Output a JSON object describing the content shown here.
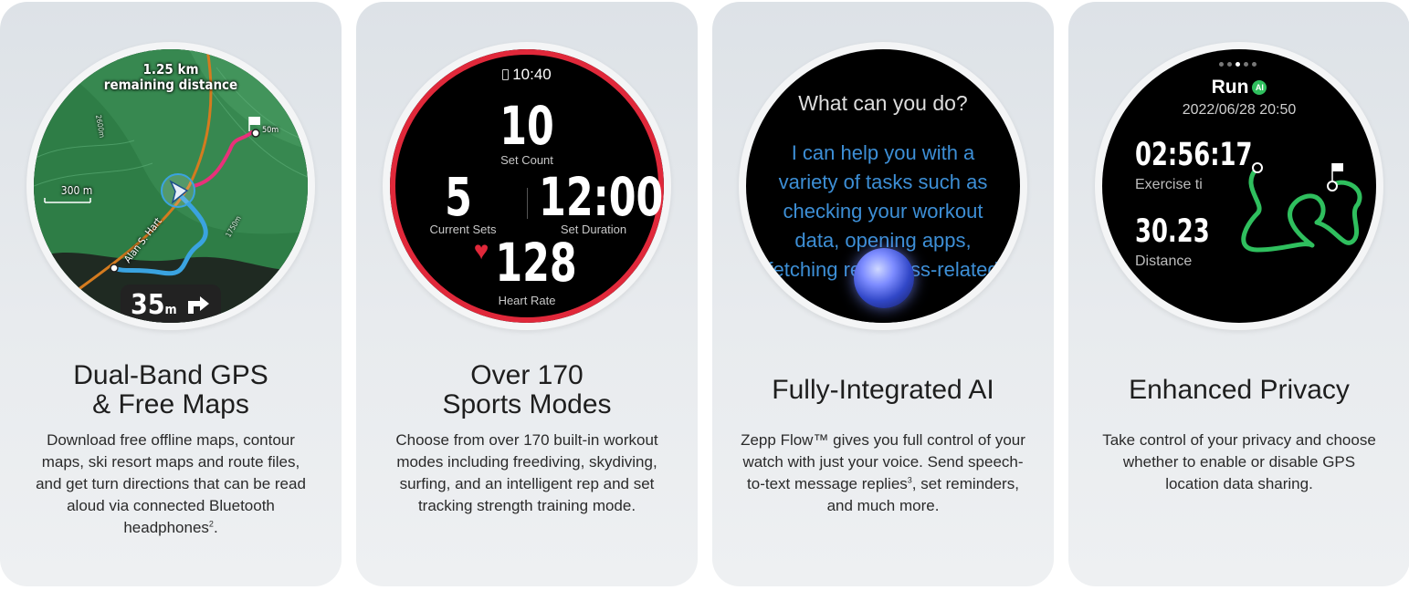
{
  "cards": [
    {
      "title_lines": [
        "Dual-Band GPS",
        "& Free Maps"
      ],
      "description": "Download free offline maps, contour maps, ski resort maps and route files, and get turn directions that can be read aloud via connected Bluetooth headphones",
      "footnote": "2",
      "desc_end": ".",
      "screen": {
        "distance_value": "1.25 km",
        "distance_label": "remaining distance",
        "scale_label": "300 m",
        "road_label": "Alan S. Hart",
        "turn_distance": "35",
        "turn_unit": "m",
        "flag_label": "50m",
        "contour_label_1": "2600m",
        "contour_label_2": "1750m",
        "route_color": "#e8317a",
        "track_color": "#3aa3e0",
        "terrain_color": "#2e7d46"
      }
    },
    {
      "title_lines": [
        "Over 170",
        "Sports Modes"
      ],
      "description": "Choose from over 170 built-in workout modes including freediving, skydiving, surfing, and an intelligent rep and set tracking strength training mode.",
      "screen": {
        "time": "10:40",
        "set_count_value": "10",
        "set_count_label": "Set Count",
        "current_sets_value": "5",
        "current_sets_label": "Current Sets",
        "set_duration_value": "12:00",
        "set_duration_label": "Set Duration",
        "heart_rate_value": "128",
        "heart_rate_label": "Heart Rate",
        "ring_color": "#e0283a"
      }
    },
    {
      "title_lines": [
        "Fully-Integrated AI"
      ],
      "description": "Zepp Flow™ gives you full control of your watch with just your voice. Send speech-to-text message replies",
      "footnote": "3",
      "desc_end": ", set reminders, and much more.",
      "screen": {
        "question": "What can you do?",
        "answer": "I can help you with a variety of tasks such as checking your workout data, opening apps, fetching readiness-related d",
        "answer_color": "#3d8fd6"
      }
    },
    {
      "title_lines": [
        "Enhanced Privacy"
      ],
      "description": "Take control of your privacy and choose whether to enable or disable GPS location data sharing.",
      "screen": {
        "activity": "Run",
        "ai_badge": "AI",
        "datetime": "2022/06/28 20:50",
        "time_value": "02:56:17",
        "time_label": "Exercise ti",
        "distance_value": "30.23",
        "distance_label": "Distance",
        "route_color": "#2fbf5e"
      }
    }
  ]
}
